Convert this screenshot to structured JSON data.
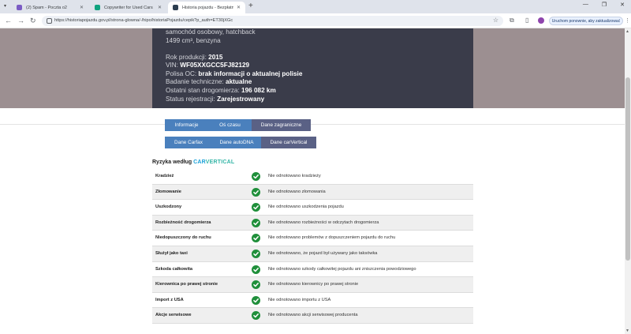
{
  "browser": {
    "tabs": [
      {
        "label": "(2) Spam - Poczta o2",
        "favicon_color": "#7b5cc4"
      },
      {
        "label": "Copywriter for Used Cars",
        "favicon_color": "#10a37f"
      },
      {
        "label": "Historia pojazdu - Bezpłatny ra",
        "favicon_color": "#2c3e50"
      }
    ],
    "new_tab": "+",
    "url": "https://historiapojazdu.gov.pl/strona-glowna/-/hipo/historiaPojazdu/cepik?p_auth=ET30jXGc",
    "update_button": "Uruchom ponownie, aby zaktualizować",
    "icons": [
      "back-icon",
      "forward-icon",
      "reload-icon",
      "star-icon",
      "extensions-icon",
      "sidebar-icon",
      "profile-icon",
      "menu-icon"
    ]
  },
  "vehicle": {
    "type_line": "samochód osobowy, hatchback",
    "engine_line": "1499 cm³, benzyna",
    "production_year_label": "Rok produkcji:",
    "production_year": "2015",
    "vin_label": "VIN:",
    "vin": "WF05XXGCC5FJ82129",
    "oc_label": "Polisa OC:",
    "oc_value": "brak informacji o aktualnej polisie",
    "inspection_label": "Badanie techniczne:",
    "inspection_value": "aktualne",
    "odometer_label": "Ostatni stan drogomierza:",
    "odometer_value": "196 082 km",
    "registration_label": "Status rejestracji:",
    "registration_value": "Zarejestrowany"
  },
  "tabs_row1": [
    {
      "label": "Informacje"
    },
    {
      "label": "Oś czasu"
    },
    {
      "label": "Dane zagraniczne"
    }
  ],
  "tabs_row2": [
    {
      "label": "Dane Carfax"
    },
    {
      "label": "Dane autoDNA"
    },
    {
      "label": "Dane carVertical"
    }
  ],
  "risks_section": {
    "title": "Ryzyka według",
    "brand_part1": "CAR",
    "brand_part2": "VERTICAL"
  },
  "risks": [
    {
      "name": "Kradzież",
      "status": "Nie odnotowano kradzieży"
    },
    {
      "name": "Złomowanie",
      "status": "Nie odnotowano złomowania"
    },
    {
      "name": "Uszkodzony",
      "status": "Nie odnotowano uszkodzenia pojazdu"
    },
    {
      "name": "Rozbieżność drogomierza",
      "status": "Nie odnotowano rozbieżności w odczytach drogomierza"
    },
    {
      "name": "Niedopuszczony do ruchu",
      "status": "Nie odnotowano problemów z dopuszczeniem pojazdu do ruchu"
    },
    {
      "name": "Służył jako taxi",
      "status": "Nie odnotowano, że pojazd był używany jako taksówka"
    },
    {
      "name": "Szkoda całkowita",
      "status": "Nie odnotowano szkody całkowitej pojazdu ani zniszczenia powodziowego"
    },
    {
      "name": "Kierownica po prawej stronie",
      "status": "Nie odnotowano kierownicy po prawej stronie"
    },
    {
      "name": "Import z USA",
      "status": "Nie odnotowano importu z USA"
    },
    {
      "name": "Akcje serwisowe",
      "status": "Nie odnotowano akcji serwisowej producenta"
    }
  ],
  "colors": {
    "accent_blue": "#4a80bd",
    "active_tab": "#5a6185",
    "ok_green": "#1f8f3a",
    "hero_bg": "#9c8f91",
    "infobox_bg": "#3a3c4a"
  }
}
